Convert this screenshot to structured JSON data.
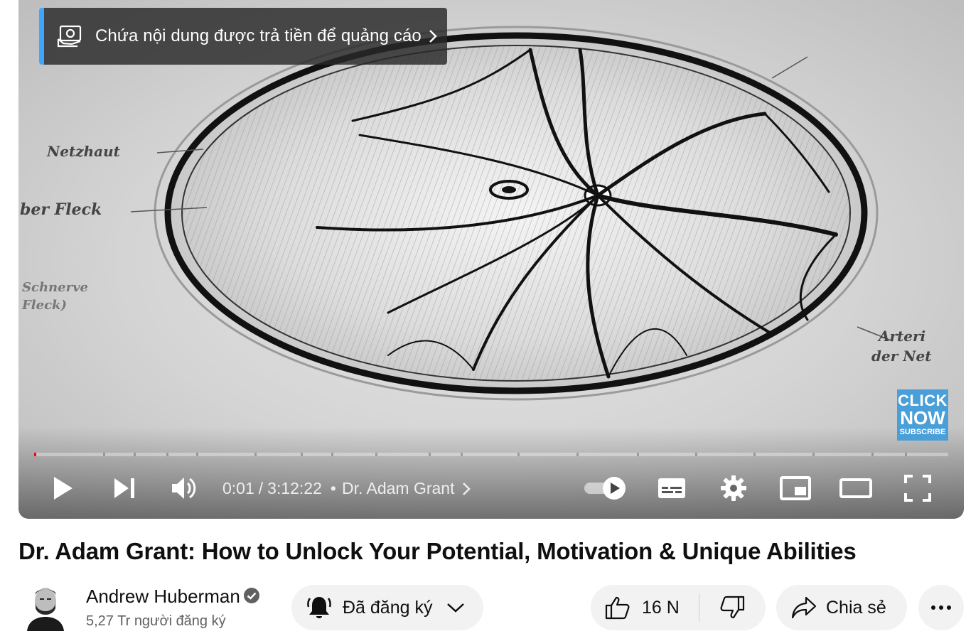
{
  "promo": {
    "text": "Chứa nội dung được trả tiền để quảng cáo",
    "accent": "#3ea6ff"
  },
  "overlay_badge": {
    "line1": "CLICK",
    "line2": "NOW",
    "line3": "SUBSCRIBE"
  },
  "artwork_labels": {
    "l1": "Netzhaut",
    "l2": "ber Fleck",
    "l3": "Schnerve",
    "l4": "Fleck)",
    "l5": "Arteri",
    "l6": "der Net"
  },
  "player": {
    "progress_fraction": 0.0001,
    "current_time": "0:01",
    "duration": "3:12:22",
    "separator": "/",
    "chapter_dot": "•",
    "chapter": "Dr. Adam Grant",
    "autoplay": true
  },
  "video": {
    "title": "Dr. Adam Grant: How to Unlock Your Potential, Motivation & Unique Abilities"
  },
  "channel": {
    "name": "Andrew Huberman",
    "subscribers": "5,27 Tr người đăng ký",
    "verified": true
  },
  "actions": {
    "subscribed_label": "Đã đăng ký",
    "like_count": "16 N",
    "share_label": "Chia sẻ"
  },
  "colors": {
    "progress_played": "#ff0000",
    "pill_bg": "#f2f2f2",
    "text_primary": "#0f0f0f",
    "text_secondary": "#606060"
  },
  "icons": [
    "paid-promotion-icon",
    "chevron-right-icon",
    "play-icon",
    "next-icon",
    "volume-icon",
    "autoplay-toggle-icon",
    "subtitles-icon",
    "settings-gear-icon",
    "miniplayer-icon",
    "theater-mode-icon",
    "fullscreen-icon",
    "verified-check-icon",
    "bell-icon",
    "chevron-down-icon",
    "thumbs-up-icon",
    "thumbs-down-icon",
    "share-arrow-icon",
    "more-dots-icon"
  ]
}
